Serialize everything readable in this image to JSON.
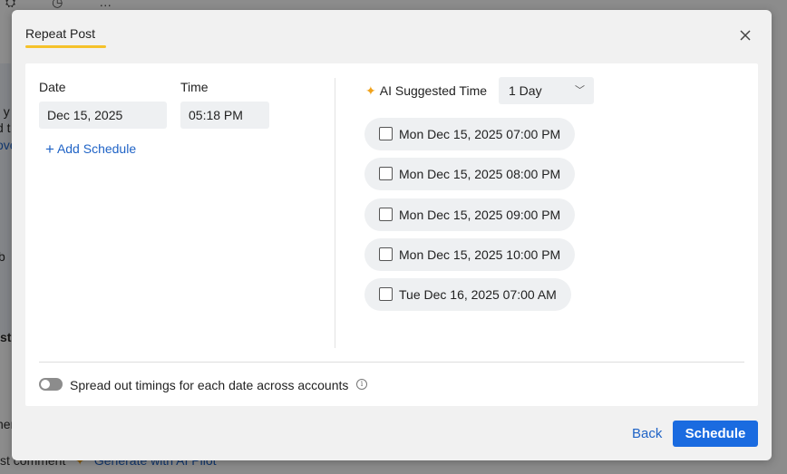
{
  "background": {
    "fragments": [
      "t y",
      "d t",
      "ove",
      "b",
      "st",
      "her"
    ],
    "bottom_text": "st comment",
    "bottom_link": "Generate with AI Pilot",
    "top_icons": "⛭ ◷ …"
  },
  "modal": {
    "tab_label": "Repeat Post",
    "date_label": "Date",
    "date_value": "Dec 15, 2025",
    "time_label": "Time",
    "time_value": "05:18 PM",
    "add_schedule_label": "Add Schedule",
    "ai_suggested_label": "AI Suggested Time",
    "ai_range_value": "1 Day",
    "suggested_slots": [
      {
        "label": "Mon Dec 15, 2025 07:00 PM",
        "checked": false
      },
      {
        "label": "Mon Dec 15, 2025 08:00 PM",
        "checked": false
      },
      {
        "label": "Mon Dec 15, 2025 09:00 PM",
        "checked": false
      },
      {
        "label": "Mon Dec 15, 2025 10:00 PM",
        "checked": false
      },
      {
        "label": "Tue Dec 16, 2025 07:00 AM",
        "checked": false
      }
    ],
    "spread_toggle_label": "Spread out timings for each date across accounts",
    "spread_toggle_on": false,
    "back_label": "Back",
    "schedule_label": "Schedule"
  },
  "colors": {
    "accent": "#1a6be0",
    "tab_underline": "#f5c22b",
    "link": "#1f63c6"
  }
}
